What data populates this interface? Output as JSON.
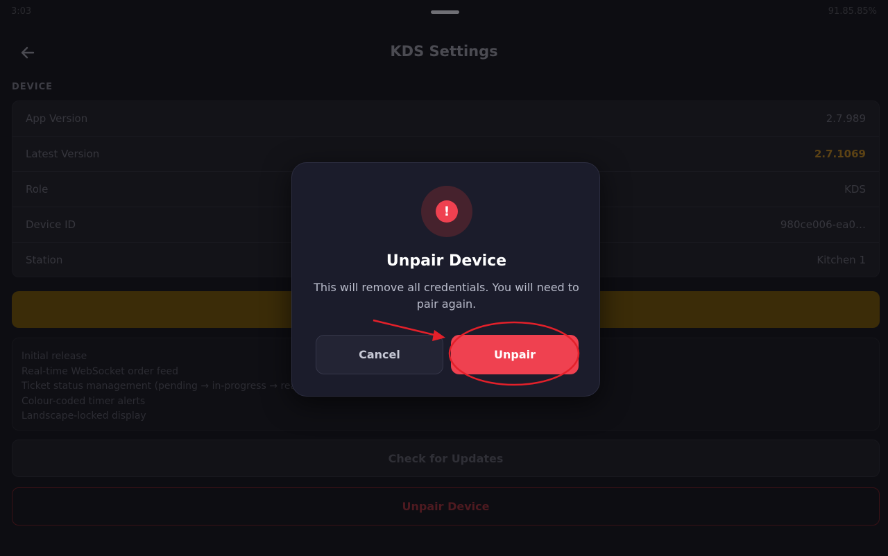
{
  "status_bar": {
    "time": "3:03",
    "right": "91.85.85%"
  },
  "header": {
    "title": "KDS Settings"
  },
  "device": {
    "section_label": "DEVICE",
    "rows": [
      {
        "label": "App Version",
        "value": "2.7.989"
      },
      {
        "label": "Latest Version",
        "value": "2.7.1069"
      },
      {
        "label": "Role",
        "value": "KDS"
      },
      {
        "label": "Device ID",
        "value": "980ce006-ea0…"
      },
      {
        "label": "Station",
        "value": "Kitchen 1"
      }
    ]
  },
  "release_notes": [
    "Initial release",
    "Real-time WebSocket order feed",
    "Ticket status management (pending → in-progress → ready)",
    "Colour-coded timer alerts",
    "Landscape-locked display"
  ],
  "actions": {
    "check_updates": "Check for Updates",
    "unpair_device": "Unpair Device"
  },
  "dialog": {
    "icon": "!",
    "title": "Unpair Device",
    "message": "This will remove all credentials. You will need to pair again.",
    "cancel_label": "Cancel",
    "confirm_label": "Unpair"
  },
  "colors": {
    "accent_amber": "#d89a1c",
    "danger_red": "#ef4150",
    "dialog_bg": "#1b1c2b",
    "annotation_red": "#e3202a"
  }
}
